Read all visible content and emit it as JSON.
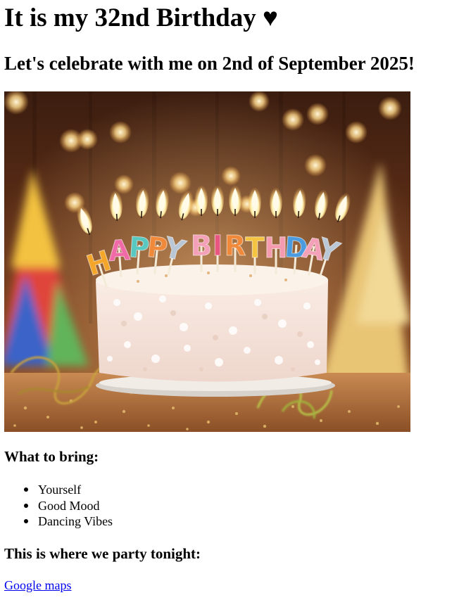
{
  "header": {
    "title": "It is my 32nd Birthday ♥",
    "subtitle": "Let's celebrate with me on 2nd of September 2025!"
  },
  "hero_image": {
    "candle_letters": [
      "H",
      "A",
      "P",
      "P",
      "Y",
      "B",
      "I",
      "R",
      "T",
      "H",
      "D",
      "A",
      "Y"
    ],
    "candle_colors": [
      "#f4a62a",
      "#f06aa8",
      "#58c8c0",
      "#f08a3a",
      "#b9c7d6",
      "#f3a0b8",
      "#e8577f",
      "#f08a3a",
      "#f5c542",
      "#f59bb0",
      "#4a9be0",
      "#f3a0b8",
      "#b9c7d6"
    ]
  },
  "bring": {
    "heading": "What to bring:",
    "items": [
      "Yourself",
      "Good Mood",
      "Dancing Vibes"
    ]
  },
  "party": {
    "heading": "This is where we party tonight:",
    "link_label": "Google maps"
  },
  "colors": {
    "link": "#0000ee",
    "text": "#000000",
    "background": "#ffffff"
  }
}
